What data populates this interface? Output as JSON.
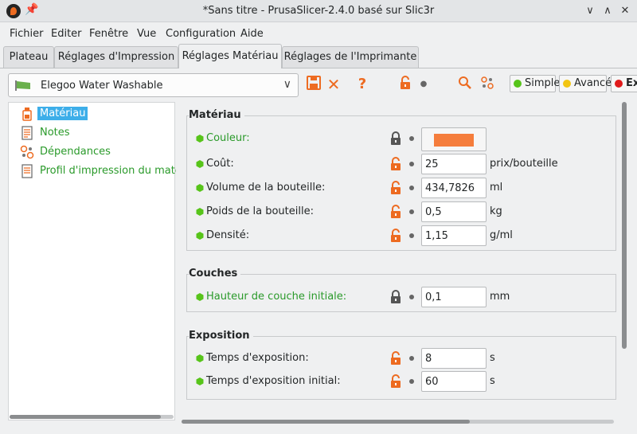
{
  "window": {
    "title": "*Sans titre - PrusaSlicer-2.4.0 basé sur Slic3r"
  },
  "menu": [
    "Fichier",
    "Editer",
    "Fenêtre",
    "Vue",
    "Configuration",
    "Aide"
  ],
  "tabs": [
    "Plateau",
    "Réglages d'Impression",
    "Réglages Matériau",
    "Réglages de l'Imprimante"
  ],
  "active_tab": "Réglages Matériau",
  "toolbar": {
    "preset": "Elegoo Water Washable",
    "modes": [
      {
        "label": "Simple",
        "color": "#57c41a"
      },
      {
        "label": "Avancé",
        "color": "#f2c512"
      },
      {
        "label": "Ex",
        "color": "#e01a1a"
      }
    ]
  },
  "tree": [
    {
      "label": "Matériau",
      "icon": "resin-bottle-icon",
      "selected": true
    },
    {
      "label": "Notes",
      "icon": "notes-icon"
    },
    {
      "label": "Dépendances",
      "icon": "dependencies-icon"
    },
    {
      "label": "Profil d'impression du matériau",
      "icon": "profile-icon"
    }
  ],
  "groups": [
    {
      "title": "Matériau",
      "rows": [
        {
          "label": "Couleur:",
          "color_value": "#f57d3c",
          "locked": true,
          "green": true
        },
        {
          "label": "Coût:",
          "value": "25",
          "unit": "prix/bouteille",
          "locked": false
        },
        {
          "label": "Volume de la bouteille:",
          "value": "434,7826",
          "unit": "ml",
          "locked": false
        },
        {
          "label": "Poids de la bouteille:",
          "value": "0,5",
          "unit": "kg",
          "locked": false
        },
        {
          "label": "Densité:",
          "value": "1,15",
          "unit": "g/ml",
          "locked": false
        }
      ]
    },
    {
      "title": "Couches",
      "rows": [
        {
          "label": "Hauteur de couche initiale:",
          "value": "0,1",
          "unit": "mm",
          "locked": true,
          "green": true
        }
      ]
    },
    {
      "title": "Exposition",
      "rows": [
        {
          "label": "Temps d'exposition:",
          "value": "8",
          "unit": "s",
          "locked": false
        },
        {
          "label": "Temps d'exposition initial:",
          "value": "60",
          "unit": "s",
          "locked": false
        }
      ]
    }
  ],
  "colors": {
    "accent": "#3daee9",
    "green": "#2a9a2a",
    "orange": "#ed6b21"
  }
}
